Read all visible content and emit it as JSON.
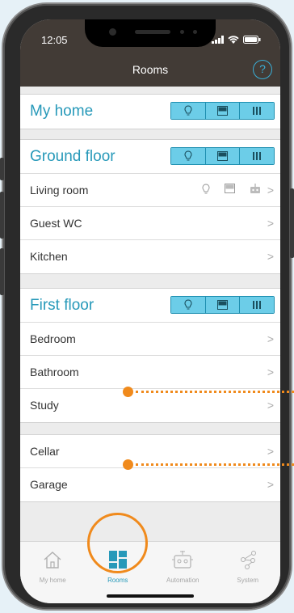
{
  "status_bar": {
    "time": "12:05"
  },
  "header": {
    "title": "Rooms",
    "help_label": "?"
  },
  "sections": [
    {
      "title": "My home",
      "toggles": [
        "bulb-icon",
        "shutter-icon",
        "radiator-icon"
      ],
      "rooms": []
    },
    {
      "title": "Ground floor",
      "toggles": [
        "bulb-icon",
        "shutter-icon",
        "radiator-icon"
      ],
      "rooms": [
        {
          "label": "Living room",
          "has_icons": true
        },
        {
          "label": "Guest WC"
        },
        {
          "label": "Kitchen"
        }
      ]
    },
    {
      "title": "First floor",
      "toggles": [
        "bulb-icon",
        "shutter-icon",
        "radiator-icon"
      ],
      "rooms": [
        {
          "label": "Bedroom"
        },
        {
          "label": "Bathroom"
        },
        {
          "label": "Study"
        }
      ]
    },
    {
      "title": "",
      "rooms": [
        {
          "label": "Cellar"
        },
        {
          "label": "Garage"
        }
      ]
    }
  ],
  "chevron": ">",
  "tabs": [
    {
      "label": "My home",
      "icon": "house-icon",
      "active": false
    },
    {
      "label": "Rooms",
      "icon": "rooms-grid-icon",
      "active": true
    },
    {
      "label": "Automation",
      "icon": "robot-icon",
      "active": false
    },
    {
      "label": "System",
      "icon": "network-icon",
      "active": false
    }
  ],
  "colors": {
    "accent": "#2799b9",
    "toggle_fill": "#6ccde8",
    "header_bg": "#423b36",
    "annotation": "#f08a1c"
  }
}
